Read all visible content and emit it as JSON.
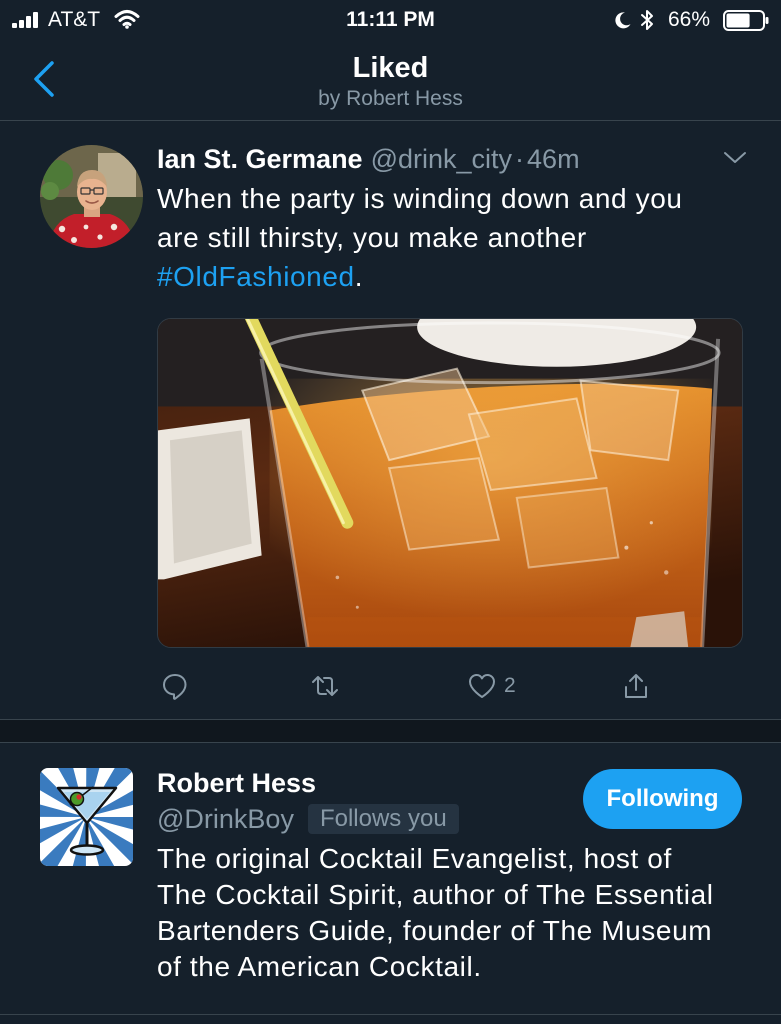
{
  "colors": {
    "background": "#15202B",
    "band": "#10171E",
    "border": "#38444D",
    "text_primary": "#FFFFFF",
    "text_secondary": "#8899A6",
    "accent": "#1DA1F2",
    "badge_bg": "#253341"
  },
  "status_bar": {
    "carrier": "AT&T",
    "time": "11:11 PM",
    "battery_percent": "66%",
    "battery_level": 0.66
  },
  "header": {
    "title": "Liked",
    "subtitle": "by Robert Hess"
  },
  "tweet": {
    "author_name": "Ian St. Germane",
    "author_handle": "@drink_city",
    "separator": "·",
    "time_ago": "46m",
    "text_before": "When the party is winding down and you are still thirsty, you make another ",
    "hashtag": "#OldFashioned",
    "text_after": ".",
    "like_count": "2"
  },
  "user_card": {
    "name": "Robert Hess",
    "handle": "@DrinkBoy",
    "follows_you_badge": "Follows you",
    "follow_button_label": "Following",
    "bio": "The original Cocktail Evangelist, host of The Cocktail Spirit, author of The Essential Bartenders Guide, founder of The Museum of the American Cocktail."
  }
}
